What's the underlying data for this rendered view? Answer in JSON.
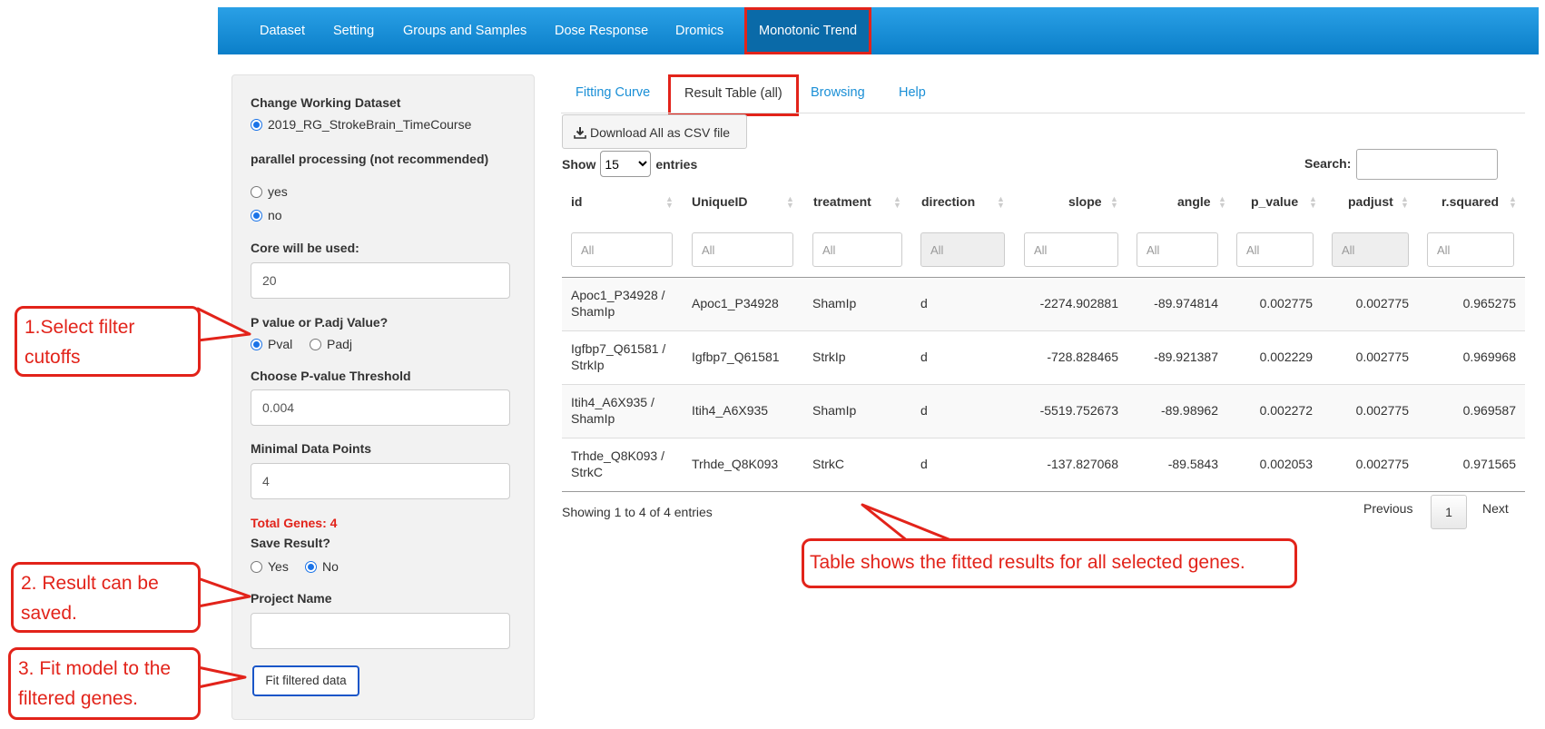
{
  "navbar": {
    "items": [
      "Dataset",
      "Setting",
      "Groups and Samples",
      "Dose Response",
      "Dromics",
      "Monotonic Trend"
    ],
    "active_index": 5
  },
  "sidebar": {
    "change_dataset_label": "Change Working Dataset",
    "dataset_option": "2019_RG_StrokeBrain_TimeCourse",
    "parallel_label": "parallel processing (not recommended)",
    "parallel_options": [
      "yes",
      "no"
    ],
    "parallel_selected": "no",
    "core_label": "Core will be used:",
    "core_value": "20",
    "pval_label": "P value or P.adj Value?",
    "pval_options": [
      "Pval",
      "Padj"
    ],
    "pval_selected": "Pval",
    "threshold_label": "Choose P-value Threshold",
    "threshold_value": "0.004",
    "min_points_label": "Minimal Data Points",
    "min_points_value": "4",
    "total_genes": "Total Genes: 4",
    "save_label": "Save Result?",
    "save_options": [
      "Yes",
      "No"
    ],
    "save_selected": "No",
    "project_label": "Project Name",
    "project_value": "",
    "fit_button": "Fit filtered data"
  },
  "tabs": [
    "Fitting Curve",
    "Result Table (all)",
    "Browsing",
    "Help"
  ],
  "active_tab": 1,
  "download_button": "Download All as CSV file",
  "show_entries": {
    "prefix": "Show",
    "value": "15",
    "suffix": "entries"
  },
  "search_label": "Search:",
  "table": {
    "columns": [
      "id",
      "UniqueID",
      "treatment",
      "direction",
      "slope",
      "angle",
      "p_value",
      "padjust",
      "r.squared"
    ],
    "filter_placeholder": "All",
    "rows": [
      {
        "id1": "Apoc1_P34928 /",
        "id2": "ShamIp",
        "UniqueID": "Apoc1_P34928",
        "treatment": "ShamIp",
        "direction": "d",
        "slope": "-2274.902881",
        "angle": "-89.974814",
        "p_value": "0.002775",
        "padjust": "0.002775",
        "r_squared": "0.965275"
      },
      {
        "id1": "Igfbp7_Q61581 /",
        "id2": "StrkIp",
        "UniqueID": "Igfbp7_Q61581",
        "treatment": "StrkIp",
        "direction": "d",
        "slope": "-728.828465",
        "angle": "-89.921387",
        "p_value": "0.002229",
        "padjust": "0.002775",
        "r_squared": "0.969968"
      },
      {
        "id1": "Itih4_A6X935 /",
        "id2": "ShamIp",
        "UniqueID": "Itih4_A6X935",
        "treatment": "ShamIp",
        "direction": "d",
        "slope": "-5519.752673",
        "angle": "-89.98962",
        "p_value": "0.002272",
        "padjust": "0.002775",
        "r_squared": "0.969587"
      },
      {
        "id1": "Trhde_Q8K093 /",
        "id2": "StrkC",
        "UniqueID": "Trhde_Q8K093",
        "treatment": "StrkC",
        "direction": "d",
        "slope": "-137.827068",
        "angle": "-89.5843",
        "p_value": "0.002053",
        "padjust": "0.002775",
        "r_squared": "0.971565"
      }
    ]
  },
  "table_info": "Showing 1 to 4 of 4 entries",
  "pagination": {
    "previous": "Previous",
    "page": "1",
    "next": "Next"
  },
  "callouts": {
    "c1": [
      "1.Select filter",
      "cutoffs"
    ],
    "c2": [
      "2. Result can be",
      "saved."
    ],
    "c3": [
      "3. Fit model to the",
      "filtered genes."
    ],
    "c4": "Table shows the fitted results for all selected genes."
  },
  "colors": {
    "navbar": "#1a8fd6",
    "highlight": "#e2231a",
    "link": "#1a8fd6",
    "selected_radio": "#1a73e8"
  }
}
